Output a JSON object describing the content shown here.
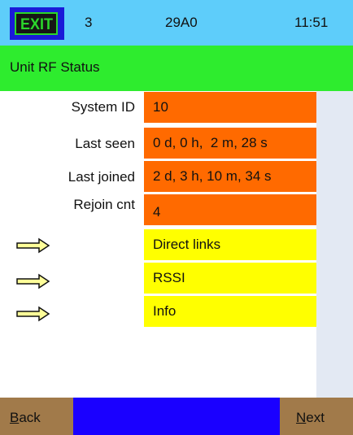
{
  "header": {
    "exit_label": "EXIT",
    "channel": "3",
    "unit_id": "29A0",
    "time": "11:51"
  },
  "screen": {
    "title": "Unit RF Status"
  },
  "fields": {
    "system_id": {
      "label": "System ID",
      "value": "10"
    },
    "last_seen": {
      "label": "Last seen",
      "value": "0 d, 0 h,  2 m, 28 s"
    },
    "last_joined": {
      "label": "Last joined",
      "value": "2 d, 3 h, 10 m, 34 s"
    },
    "rejoin_cnt": {
      "label": "Rejoin cnt",
      "value": "4"
    }
  },
  "links": {
    "direct_links": "Direct links",
    "rssi": "RSSI",
    "info": "Info"
  },
  "footer": {
    "back_label": "Back",
    "next_label": "Next"
  },
  "colors": {
    "header_bg": "#5ecdfa",
    "title_bg": "#2eec2e",
    "value_bg": "#ff6a00",
    "link_bg": "#ffff00",
    "footer_bg": "#1a00ff",
    "nav_button_bg": "#a17a4a"
  },
  "icons": {
    "exit": "exit-sign-icon",
    "link_arrow": "right-arrow-icon"
  }
}
